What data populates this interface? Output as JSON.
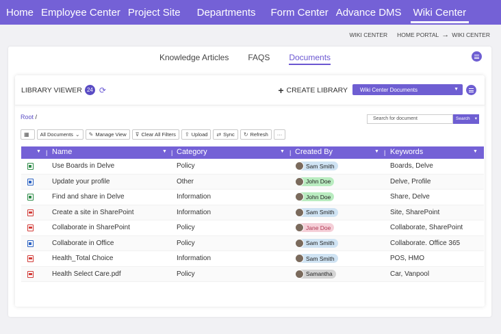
{
  "topnav": {
    "items": [
      {
        "label": "Home"
      },
      {
        "label": "Employee Center"
      },
      {
        "label": "Project Site"
      },
      {
        "label": "Departments"
      },
      {
        "label": "Form Center"
      },
      {
        "label": "Advance DMS"
      },
      {
        "label": "Wiki Center"
      }
    ],
    "active_index": 6
  },
  "breadcrumb": {
    "current": "WIKI CENTER",
    "home": "HOME PORTAL",
    "arrow": "→",
    "target": "WIKI CENTER"
  },
  "tabs": [
    {
      "label": "Knowledge Articles"
    },
    {
      "label": "FAQS"
    },
    {
      "label": "Documents"
    }
  ],
  "library": {
    "title": "LIBRARY VIEWER",
    "count": "24",
    "create_label": "CREATE LIBRARY",
    "selected_library": "Wiki Center Documents"
  },
  "path": {
    "root": "Root",
    "slash": "/"
  },
  "search": {
    "placeholder": "Search for document",
    "button": "Search"
  },
  "toolbar": {
    "all_documents": "All Documents",
    "manage_view": "Manage View",
    "clear_filters": "Clear All Filters",
    "upload": "Upload",
    "sync": "Sync",
    "refresh": "Refresh",
    "more": "···"
  },
  "grid": {
    "columns": [
      "Name",
      "Category",
      "Created By",
      "Keywords"
    ],
    "rows": [
      {
        "icon": "excel-file-icon",
        "name": "Use Boards in Delve",
        "category": "Policy",
        "created_by": "Sam Smith",
        "chip": "blue",
        "keywords": "Boards, Delve"
      },
      {
        "icon": "word-file-icon",
        "name": "Update your profile",
        "category": "Other",
        "created_by": "John Doe",
        "chip": "green",
        "keywords": "Delve, Profile"
      },
      {
        "icon": "excel-file-icon",
        "name": "Find and share in Delve",
        "category": "Information",
        "created_by": "John Doe",
        "chip": "green",
        "keywords": "Share, Delve"
      },
      {
        "icon": "pdf-file-icon",
        "name": "Create a site in SharePoint",
        "category": "Information",
        "created_by": "Sam Smith",
        "chip": "blue",
        "keywords": "Site, SharePoint"
      },
      {
        "icon": "pdf-file-icon",
        "name": "Collaborate in SharePoint",
        "category": "Policy",
        "created_by": "Jane Doe",
        "chip": "pink",
        "keywords": "Collaborate, SharePoint"
      },
      {
        "icon": "word-file-icon",
        "name": "Collaborate in Office",
        "category": "Policy",
        "created_by": "Sam Smith",
        "chip": "blue",
        "keywords": "Collaborate. Office 365"
      },
      {
        "icon": "pdf-file-icon",
        "name": "Health_Total Choice",
        "category": "Information",
        "created_by": "Sam Smith",
        "chip": "blue",
        "keywords": "POS, HMO"
      },
      {
        "icon": "pdf-file-icon",
        "name": "Health Select Care.pdf",
        "category": "Policy",
        "created_by": "Samantha",
        "chip": "grey",
        "keywords": "Car, Vanpool"
      }
    ]
  },
  "colors": {
    "accent": "#7461d6",
    "chip_blue": "#cfe3f3",
    "chip_green": "#b9ecc0",
    "chip_pink": "#f5cfd8",
    "chip_grey": "#d4d4d4"
  }
}
